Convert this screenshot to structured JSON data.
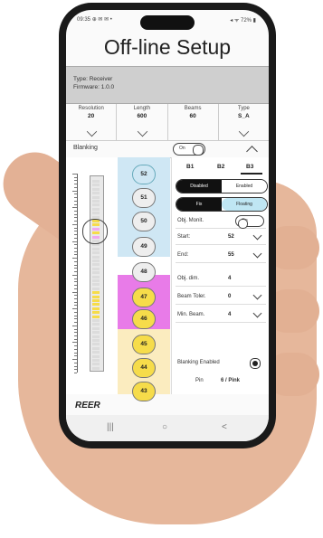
{
  "status": {
    "time": "09:35",
    "icons_left": "⊕ ✉ ✉ •",
    "right": "◂ ᯤ 72% ▮"
  },
  "title": "Off-line Setup",
  "device": {
    "type_line": "Type: Receiver",
    "firmware_line": "Firmware: 1.0.0"
  },
  "params": [
    {
      "label": "Resolution",
      "value": "20"
    },
    {
      "label": "Length",
      "value": "600"
    },
    {
      "label": "Beams",
      "value": "60"
    },
    {
      "label": "Type",
      "value": "S_A"
    }
  ],
  "blanking": {
    "label": "Blanking",
    "toggle": "On"
  },
  "ruler": {
    "labels": [
      "60",
      "55",
      "50",
      "45",
      "40",
      "35",
      "30",
      "25",
      "20",
      "15",
      "10",
      "5",
      "1"
    ]
  },
  "beams": [
    "52",
    "51",
    "50",
    "49",
    "48",
    "47",
    "46",
    "45",
    "44",
    "43"
  ],
  "colors": {
    "blue_zone": "#cfe7f4",
    "pink_zone": "#e87be8",
    "yellow_zone": "#fbecbf",
    "accent": "#222222"
  },
  "right": {
    "tabs": [
      "B1",
      "B2",
      "B3"
    ],
    "mode": [
      "Disabled",
      "Enabled"
    ],
    "fix_float": [
      "Fix",
      "Floating"
    ],
    "obj_monit": {
      "label": "Obj. Monit.",
      "value": "On"
    },
    "rows": [
      {
        "label": "Start:",
        "value": "52"
      },
      {
        "label": "End:",
        "value": "55"
      },
      {
        "label": "Obj. dim.",
        "value": "4"
      },
      {
        "label": "Beam Toler.",
        "value": "0"
      },
      {
        "label": "Min. Beam.",
        "value": "4"
      }
    ],
    "note": {
      "label": "Blanking Enabled",
      "pin": "Pin",
      "pin_value": "6 / Pink"
    }
  },
  "logo": "REER",
  "nav": {
    "recent": "|||",
    "home": "○",
    "back": "<"
  }
}
